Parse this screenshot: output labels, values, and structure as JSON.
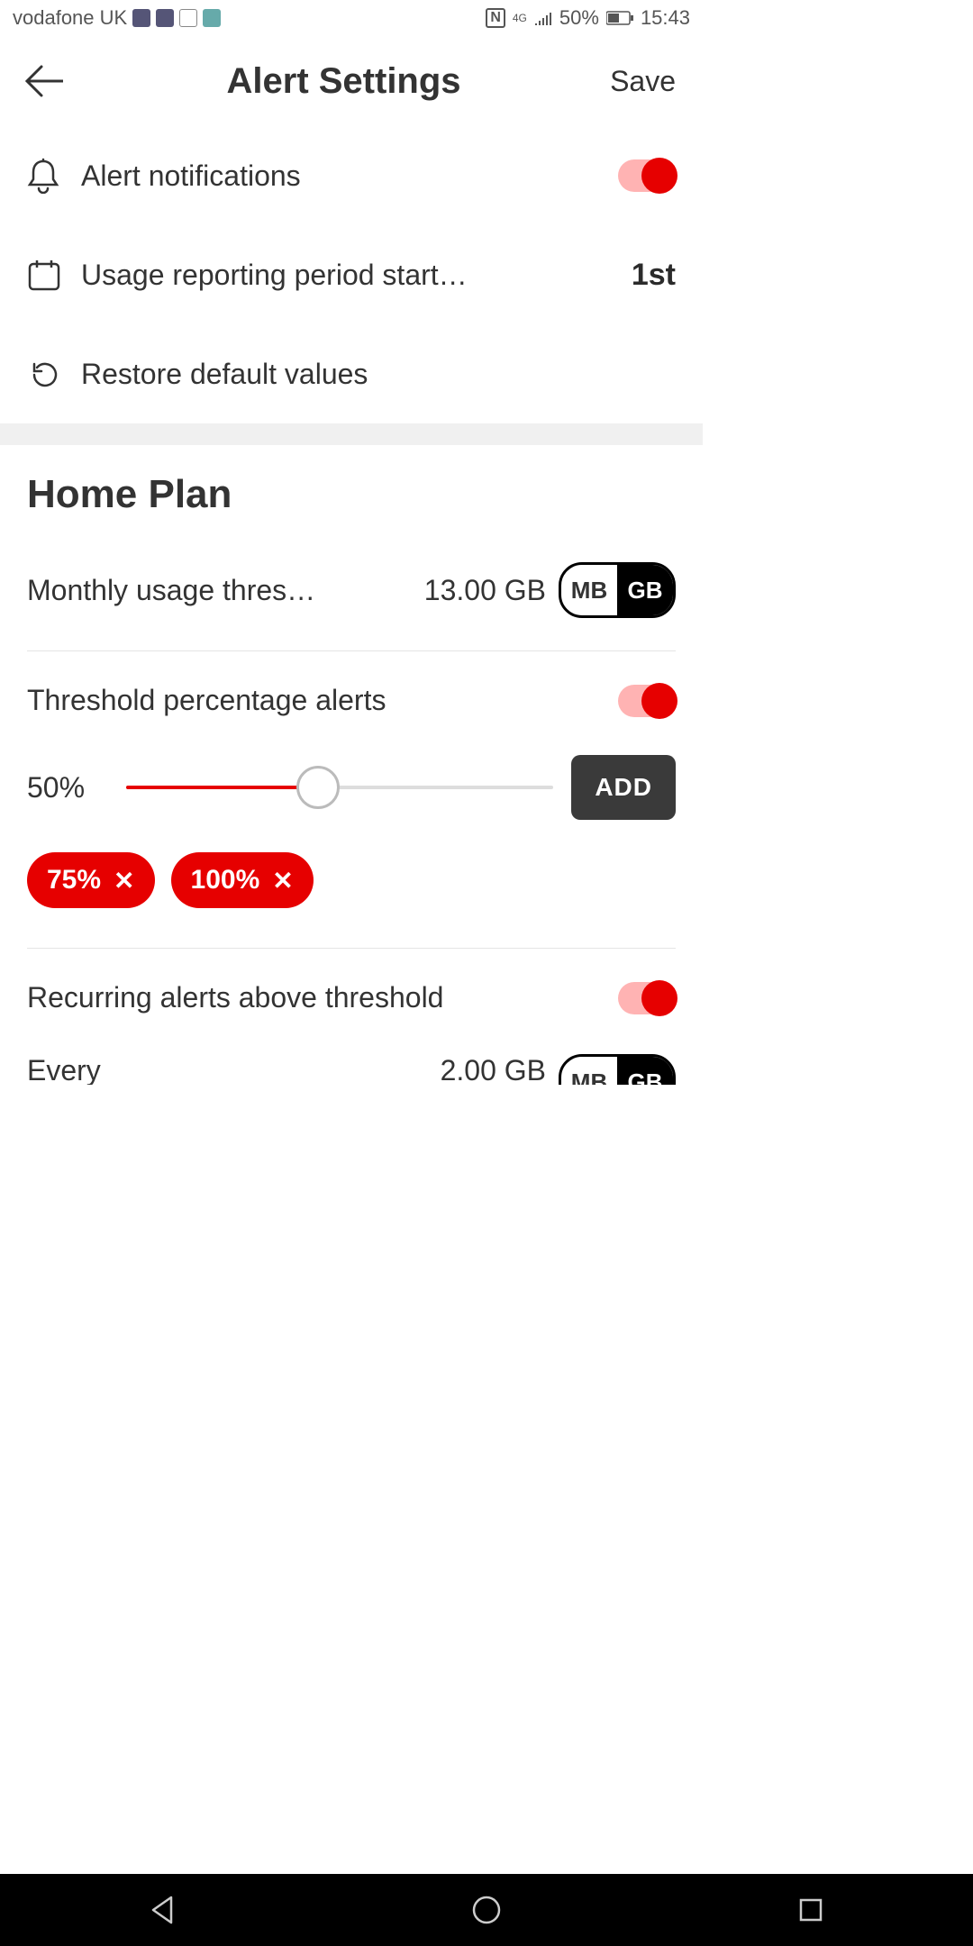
{
  "statusbar": {
    "carrier": "vodafone UK",
    "battery_pct": "50%",
    "time": "15:43",
    "net_indicator": "4G"
  },
  "header": {
    "title": "Alert Settings",
    "save": "Save"
  },
  "rows": {
    "alert_notifications": "Alert notifications",
    "usage_period": "Usage reporting period start…",
    "usage_period_value": "1st",
    "restore": "Restore default values"
  },
  "plan": {
    "title": "Home Plan",
    "monthly_thres_label": "Monthly usage thres…",
    "monthly_thres_value": "13.00 GB",
    "unit_mb": "MB",
    "unit_gb": "GB",
    "threshold_alerts_label": "Threshold percentage alerts",
    "slider_pct": "50%",
    "add_btn": "ADD",
    "chip1": "75%",
    "chip2": "100%",
    "recurring_label": "Recurring alerts above threshold",
    "every_label": "Every",
    "every_value": "2.00 GB"
  }
}
